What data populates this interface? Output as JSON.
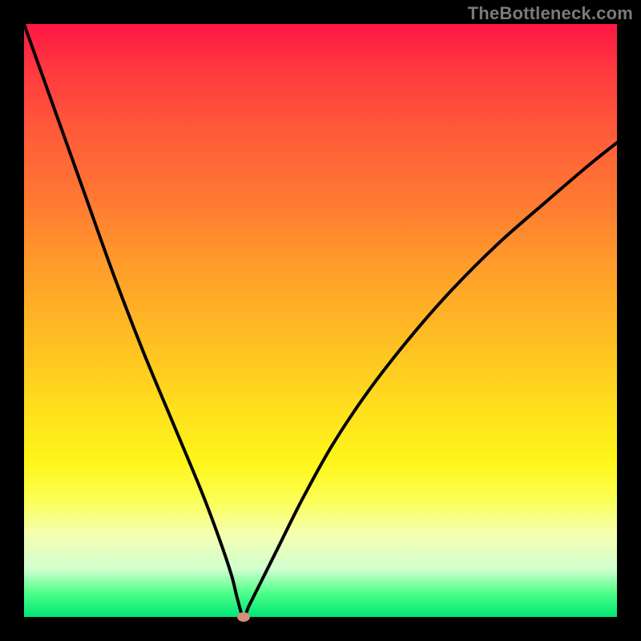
{
  "watermark": "TheBottleneck.com",
  "colors": {
    "frame_background": "#000000",
    "curve_stroke": "#000000",
    "marker_fill": "#d48e7a",
    "gradient_top": "#ff1744",
    "gradient_mid": "#ffe21c",
    "gradient_bottom": "#00e676",
    "watermark_text": "#7a7a7a"
  },
  "chart_data": {
    "type": "line",
    "title": "",
    "xlabel": "",
    "ylabel": "",
    "xlim": [
      0,
      100
    ],
    "ylim": [
      0,
      100
    ],
    "grid": false,
    "legend": false,
    "marker": {
      "x": 37,
      "y": 0
    },
    "series": [
      {
        "name": "bottleneck-curve",
        "x": [
          0,
          5,
          10,
          15,
          20,
          25,
          30,
          33,
          35,
          36,
          37,
          38,
          40,
          43,
          47,
          52,
          58,
          65,
          72,
          80,
          88,
          95,
          100
        ],
        "values": [
          100,
          86,
          72,
          58,
          45,
          33,
          21,
          13,
          7,
          3,
          0,
          2,
          6,
          12,
          20,
          29,
          38,
          47,
          55,
          63,
          70,
          76,
          80
        ]
      }
    ]
  }
}
